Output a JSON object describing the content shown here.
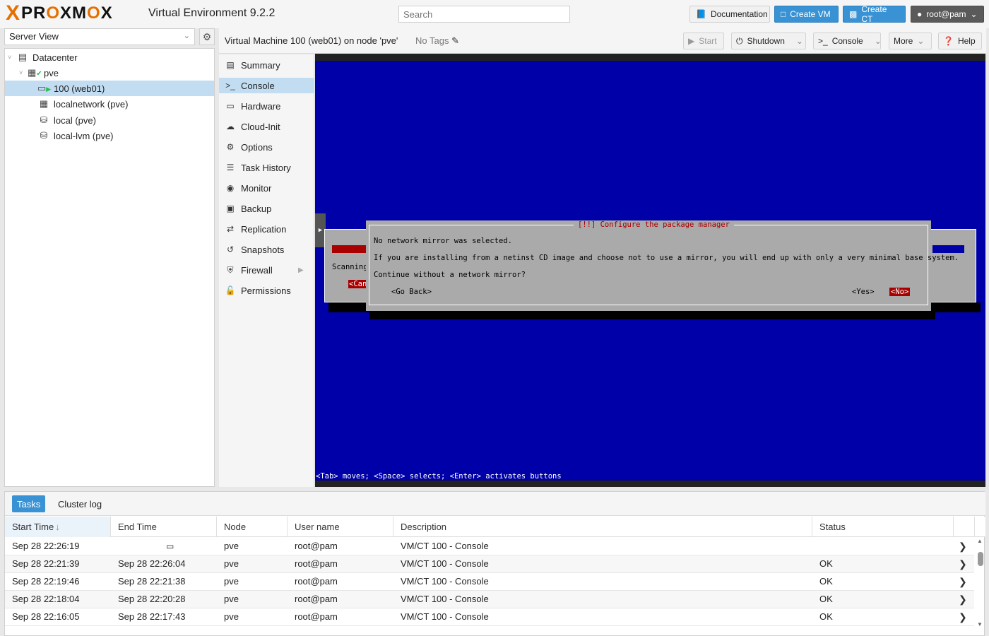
{
  "header": {
    "logo_x": "X",
    "logo_text_a": "PR",
    "logo_text_o1": "O",
    "logo_text_b": "XM",
    "logo_text_o2": "O",
    "logo_text_c": "X",
    "app_version": "Virtual Environment 9.2.2",
    "search_placeholder": "Search",
    "documentation_label": "Documentation",
    "create_vm_label": "Create VM",
    "create_ct_label": "Create CT",
    "user_label": "root@pam"
  },
  "tree": {
    "view_label": "Server View",
    "items": [
      {
        "label": "Datacenter",
        "icon": "server-rack-icon"
      },
      {
        "label": "pve",
        "icon": "node-online-icon"
      },
      {
        "label": "100 (web01)",
        "icon": "vm-running-icon"
      },
      {
        "label": "localnetwork (pve)",
        "icon": "network-grid-icon"
      },
      {
        "label": "local (pve)",
        "icon": "storage-icon"
      },
      {
        "label": "local-lvm (pve)",
        "icon": "storage-icon"
      }
    ]
  },
  "titlebar": {
    "vm_title": "Virtual Machine 100 (web01) on node 'pve'",
    "no_tags": "No Tags",
    "start_label": "Start",
    "shutdown_label": "Shutdown",
    "console_label": "Console",
    "more_label": "More",
    "help_label": "Help"
  },
  "nav": {
    "items": [
      {
        "label": "Summary",
        "icon": "book-icon"
      },
      {
        "label": "Console",
        "icon": "terminal-icon"
      },
      {
        "label": "Hardware",
        "icon": "desktop-icon"
      },
      {
        "label": "Cloud-Init",
        "icon": "cloud-icon"
      },
      {
        "label": "Options",
        "icon": "gear-icon"
      },
      {
        "label": "Task History",
        "icon": "list-icon"
      },
      {
        "label": "Monitor",
        "icon": "eye-icon"
      },
      {
        "label": "Backup",
        "icon": "floppy-icon"
      },
      {
        "label": "Replication",
        "icon": "retweet-icon"
      },
      {
        "label": "Snapshots",
        "icon": "history-icon"
      },
      {
        "label": "Firewall",
        "icon": "shield-icon"
      },
      {
        "label": "Permissions",
        "icon": "unlock-icon"
      }
    ],
    "selected": "Console"
  },
  "console": {
    "dialog_title": "[!!] Configure the package manager",
    "line1": "No network mirror was selected.",
    "line2": "If you are installing from a netinst CD image and choose not to use a mirror, you will end up with only a very minimal base system.",
    "line3": "Continue without a network mirror?",
    "go_back": "<Go Back>",
    "yes": "<Yes>",
    "no": "<No>",
    "bg_scanning": "Scanning",
    "bg_cancel": "<Can",
    "help_line": "<Tab> moves; <Space> selects; <Enter> activates buttons"
  },
  "tasks": {
    "tab_tasks": "Tasks",
    "tab_cluster_log": "Cluster log",
    "columns": [
      "Start Time",
      "End Time",
      "Node",
      "User name",
      "Description",
      "Status"
    ],
    "rows": [
      {
        "start": "Sep 28 22:26:19",
        "end": "",
        "node": "pve",
        "user": "root@pam",
        "desc": "VM/CT 100 - Console",
        "status": ""
      },
      {
        "start": "Sep 28 22:21:39",
        "end": "Sep 28 22:26:04",
        "node": "pve",
        "user": "root@pam",
        "desc": "VM/CT 100 - Console",
        "status": "OK"
      },
      {
        "start": "Sep 28 22:19:46",
        "end": "Sep 28 22:21:38",
        "node": "pve",
        "user": "root@pam",
        "desc": "VM/CT 100 - Console",
        "status": "OK"
      },
      {
        "start": "Sep 28 22:18:04",
        "end": "Sep 28 22:20:28",
        "node": "pve",
        "user": "root@pam",
        "desc": "VM/CT 100 - Console",
        "status": "OK"
      },
      {
        "start": "Sep 28 22:16:05",
        "end": "Sep 28 22:17:43",
        "node": "pve",
        "user": "root@pam",
        "desc": "VM/CT 100 - Console",
        "status": "OK"
      }
    ]
  },
  "colors": {
    "accent": "#3892d4",
    "brand": "#e57000",
    "console_bg": "#0000a8",
    "selected_row": "#c2ddf2"
  }
}
